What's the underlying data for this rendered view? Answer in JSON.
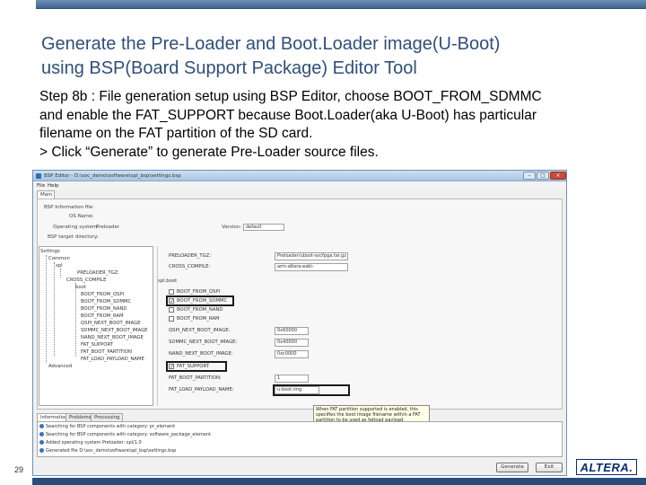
{
  "slide": {
    "title_lines": [
      "Generate the Pre-Loader and Boot.Loader image(U-Boot)",
      "using BSP(Board Support Package) Editor Tool"
    ],
    "body_lines": [
      "Step 8b : File generation setup using BSP Editor, choose BOOT_FROM_SDMMC",
      "and enable the FAT_SUPPORT because Boot.Loader(aka U-Boot) has particular",
      "filename on the FAT partition of the SD card.",
      "> Click “Generate” to generate Pre-Loader source files."
    ],
    "page_number": "29",
    "logo_text": "ALTERA."
  },
  "window": {
    "title": "BSP Editor - D:\\soc_demo\\software\\spl_bsp\\settings.bsp",
    "menu": [
      "File",
      "Help"
    ],
    "tab": "Main",
    "info": {
      "heading": "BSP Information file:",
      "os_label": "OS Name:",
      "opsys_label": "Operating system:",
      "opsys_value": "Preloader",
      "version_label": "Version:",
      "version_value": "default",
      "target_label": "BSP target directory:",
      "target_value": "."
    },
    "tree": {
      "settings": "Settings",
      "common": "Common",
      "spl": "spl",
      "items": [
        "PRELOADER_TGZ",
        "CROSS_COMPILE",
        "boot",
        "BOOT_FROM_QSPI",
        "BOOT_FROM_SDMMC",
        "BOOT_FROM_NAND",
        "BOOT_FROM_RAM",
        "QSPI_NEXT_BOOT_IMAGE",
        "SDMMC_NEXT_BOOT_IMAGE",
        "NAND_NEXT_BOOT_IMAGE",
        "FAT_SUPPORT",
        "FAT_BOOT_PARTITION",
        "FAT_LOAD_PAYLOAD_NAME"
      ],
      "advanced": "Advanced"
    },
    "panel": {
      "preloader_tgz_label": "PRELOADER_TGZ:",
      "preloader_tgz_value": "Preloader/uboot-socfpga.tar.gz",
      "cross_compile_label": "CROSS_COMPILE:",
      "cross_compile_value": "arm-altera-eabi-",
      "section": "spl.boot",
      "checks": [
        {
          "label": "BOOT_FROM_QSPI",
          "checked": false
        },
        {
          "label": "BOOT_FROM_SDMMC",
          "checked": true
        },
        {
          "label": "BOOT_FROM_NAND",
          "checked": false
        },
        {
          "label": "BOOT_FROM_RAM",
          "checked": false
        }
      ],
      "qspi_label": "QSPI_NEXT_BOOT_IMAGE:",
      "qspi_value": "0x60000",
      "sdmmc_label": "SDMMC_NEXT_BOOT_IMAGE:",
      "sdmmc_value": "0x40000",
      "nand_label": "NAND_NEXT_BOOT_IMAGE:",
      "nand_value": "0xc0000",
      "fat_support_label": "FAT_SUPPORT",
      "fat_support_checked": true,
      "fat_partition_label": "FAT_BOOT_PARTITION:",
      "fat_partition_value": "1",
      "fat_payload_label": "FAT_LOAD_PAYLOAD_NAME:",
      "fat_payload_value": "u-boot.img",
      "tooltip_lines": [
        "When FAT partition supported is enabled, this",
        "specifies the boot image filename within a FAT",
        "partition to be used as fatload payload."
      ]
    },
    "bottom_tabs": [
      "Information",
      "Problems",
      "Processing"
    ],
    "log": [
      "Searching for BSP components with category: pr_element",
      "Searching for BSP components with category: software_package_element",
      "Added operating system Preloader: spl/1.0",
      "Generated file D:\\soc_demo\\software\\spl_bsp\\settings.bsp"
    ],
    "buttons": {
      "generate": "Generate",
      "exit": "Exit"
    }
  }
}
